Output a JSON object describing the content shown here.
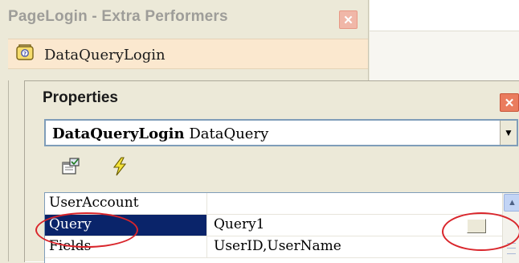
{
  "outer_window": {
    "title": "PageLogin - Extra Performers",
    "close_glyph": "✕",
    "item_label": "DataQueryLogin",
    "item_icon": "datasource-icon"
  },
  "properties_window": {
    "title": "Properties",
    "close_glyph": "✕",
    "object_name": "DataQueryLogin",
    "object_type": "DataQuery",
    "dropdown_glyph": "▼",
    "toolbar": [
      {
        "icon": "property-pages-icon"
      },
      {
        "icon": "events-lightning-icon"
      }
    ],
    "grid_rows": [
      {
        "name": "UserAccount",
        "value": ""
      },
      {
        "name": "Query",
        "value": "Query1",
        "selected": true
      },
      {
        "name": "Fields",
        "value": "UserID,UserName"
      }
    ],
    "scroll_up_glyph": "▲"
  },
  "colors": {
    "selection": "#0a246a",
    "annotation": "#d9252b",
    "close_active": "#ea7c5e"
  }
}
